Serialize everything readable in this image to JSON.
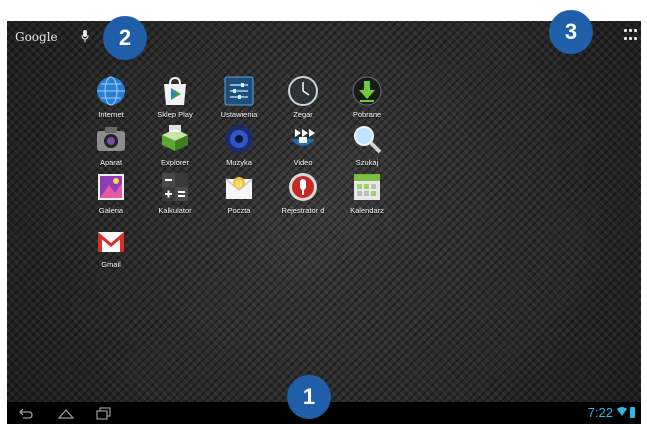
{
  "top_bar": {
    "search_label": "Google",
    "mic_icon": "microphone-icon",
    "apps_icon": "all-apps-grid-icon"
  },
  "badges": {
    "one": "1",
    "two": "2",
    "three": "3"
  },
  "apps": [
    {
      "label": "Internet",
      "icon": "globe-icon"
    },
    {
      "label": "Sklep Play",
      "icon": "play-store-icon"
    },
    {
      "label": "Ustawienia",
      "icon": "settings-icon"
    },
    {
      "label": "Zegar",
      "icon": "clock-icon"
    },
    {
      "label": "Pobrane",
      "icon": "download-icon"
    },
    {
      "label": "Aparat",
      "icon": "camera-icon"
    },
    {
      "label": "Explorer",
      "icon": "file-explorer-icon"
    },
    {
      "label": "Muzyka",
      "icon": "music-icon"
    },
    {
      "label": "Video",
      "icon": "video-icon"
    },
    {
      "label": "Szukaj",
      "icon": "search-icon"
    },
    {
      "label": "Galeria",
      "icon": "gallery-icon"
    },
    {
      "label": "Kalkulator",
      "icon": "calculator-icon"
    },
    {
      "label": "Poczta",
      "icon": "mail-icon"
    },
    {
      "label": "Rejestrator d",
      "icon": "voice-recorder-icon"
    },
    {
      "label": "Kalendarz",
      "icon": "calendar-icon"
    },
    {
      "label": "Gmail",
      "icon": "gmail-icon"
    }
  ],
  "nav": {
    "back_icon": "back-icon",
    "home_icon": "home-icon",
    "recents_icon": "recent-apps-icon"
  },
  "status": {
    "time": "7:22",
    "accent_color": "#33b5e5",
    "badge_color": "#1f5ea8"
  }
}
